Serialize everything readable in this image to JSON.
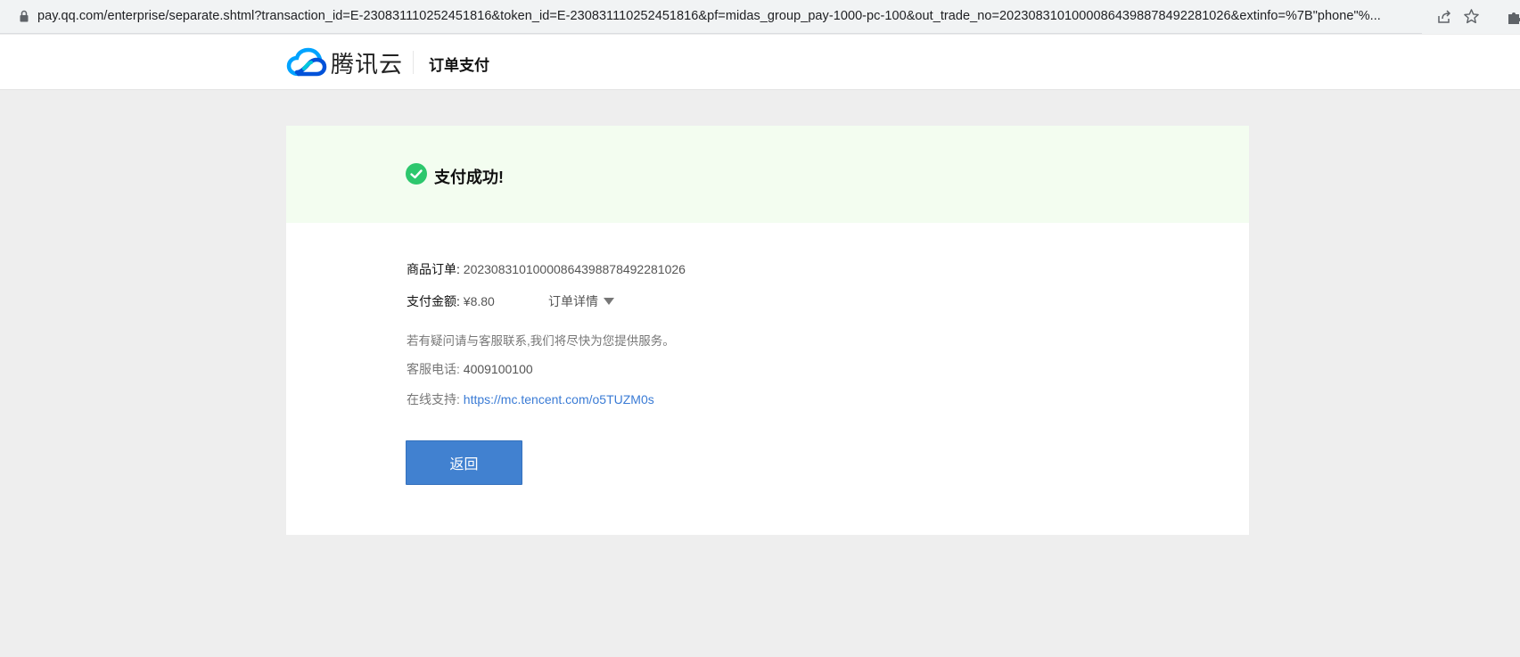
{
  "browser": {
    "url": "pay.qq.com/enterprise/separate.shtml?transaction_id=E-230831110252451816&token_id=E-230831110252451816&pf=midas_group_pay-1000-pc-100&out_trade_no=20230831010000864398878492281026&extinfo=%7B\"phone\"%...",
    "icons": [
      "lock-icon",
      "share-icon",
      "star-icon",
      "extensions-icon"
    ]
  },
  "header": {
    "brand": "腾讯云",
    "title": "订单支付",
    "brand_colors": [
      "#00a3ff",
      "#0052d9"
    ]
  },
  "status": {
    "message": "支付成功!",
    "icon": "check-circle-icon",
    "color": "#2dc76d"
  },
  "order": {
    "order_label": "商品订单:",
    "order_number": "20230831010000864398878492281026",
    "amount_label": "支付金额:",
    "amount": "¥8.80",
    "detail_toggle": "订单详情"
  },
  "support": {
    "notice": "若有疑问请与客服联系,我们将尽快为您提供服务。",
    "phone_label": "客服电话:",
    "phone": "4009100100",
    "online_label": "在线支持:",
    "online_link": "https://mc.tencent.com/o5TUZM0s"
  },
  "actions": {
    "back": "返回"
  }
}
